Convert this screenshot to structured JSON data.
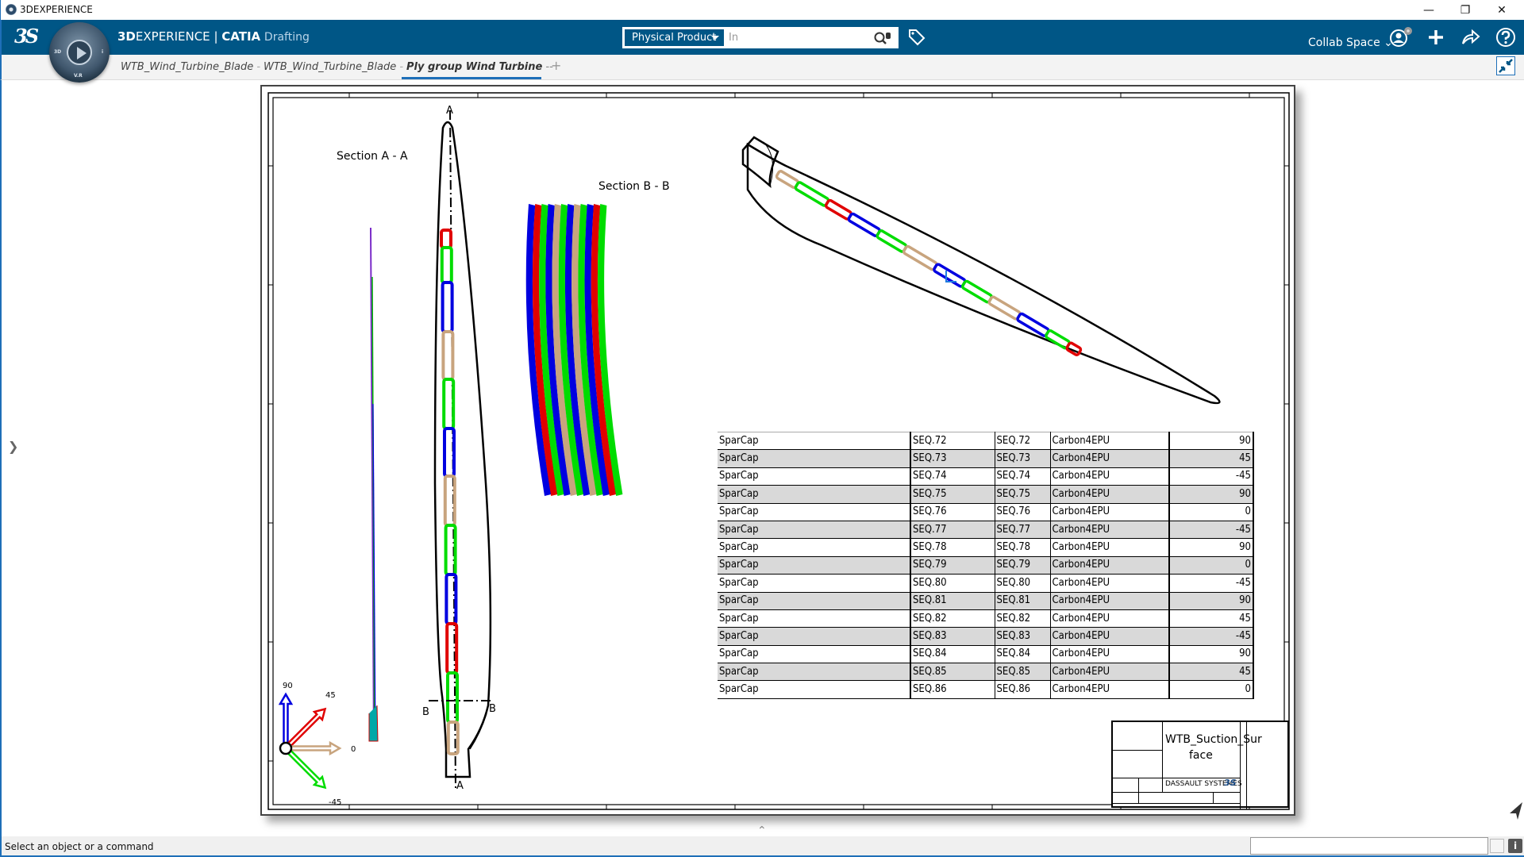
{
  "window": {
    "title": "3DEXPERIENCE",
    "controls": {
      "minimize": "—",
      "restore": "❐",
      "close": "✕"
    }
  },
  "header": {
    "brand_bold": "3D",
    "brand_rest": "EXPERIENCE",
    "brand_sep": " | ",
    "product": "CATIA",
    "app": "Drafting",
    "compass_labels": {
      "left": "3D",
      "right": "i",
      "bottom": "V.R"
    },
    "search": {
      "scope": "Physical Product",
      "value": "In",
      "placeholder": ""
    },
    "collab_space": "Collab Space ⌄",
    "icons": [
      "search-database-icon",
      "tag-icon",
      "user-profile-icon",
      "add-icon",
      "share-icon",
      "help-icon"
    ]
  },
  "tabs": [
    {
      "label": "WTB_Wind_Turbine_Blade",
      "suffix": " -",
      "active": false
    },
    {
      "label": "WTB_Wind_Turbine_Blade",
      "suffix": " -",
      "active": false
    },
    {
      "label": "Ply group Wind Turbine",
      "suffix": " --",
      "active": true
    }
  ],
  "add_tab": "+",
  "drawing": {
    "section_aa_label": "Section A - A",
    "section_bb_label": "Section B - B",
    "cut_labels": {
      "a_top": "A",
      "a_bottom": "A",
      "b_left": "B",
      "b_right": "B"
    },
    "orientation_triad": [
      {
        "angle_label": "90",
        "color": "#0000e0"
      },
      {
        "angle_label": "45",
        "color": "#e00000"
      },
      {
        "angle_label": "0",
        "color": "#c8a47e"
      },
      {
        "angle_label": "-45",
        "color": "#00dc00"
      }
    ],
    "section_bb_stripes": [
      "#0000e0",
      "#e00000",
      "#00dc00",
      "#0000e0",
      "#c8a47e",
      "#00dc00",
      "#0000e0",
      "#c8a47e",
      "#00dc00",
      "#0000e0",
      "#e00000",
      "#00dc00"
    ],
    "ply_table": [
      [
        "SparCap",
        "SEQ.72",
        "SEQ.72",
        "Carbon4EPU",
        "90"
      ],
      [
        "SparCap",
        "SEQ.73",
        "SEQ.73",
        "Carbon4EPU",
        "45"
      ],
      [
        "SparCap",
        "SEQ.74",
        "SEQ.74",
        "Carbon4EPU",
        "-45"
      ],
      [
        "SparCap",
        "SEQ.75",
        "SEQ.75",
        "Carbon4EPU",
        "90"
      ],
      [
        "SparCap",
        "SEQ.76",
        "SEQ.76",
        "Carbon4EPU",
        "0"
      ],
      [
        "SparCap",
        "SEQ.77",
        "SEQ.77",
        "Carbon4EPU",
        "-45"
      ],
      [
        "SparCap",
        "SEQ.78",
        "SEQ.78",
        "Carbon4EPU",
        "90"
      ],
      [
        "SparCap",
        "SEQ.79",
        "SEQ.79",
        "Carbon4EPU",
        "0"
      ],
      [
        "SparCap",
        "SEQ.80",
        "SEQ.80",
        "Carbon4EPU",
        "-45"
      ],
      [
        "SparCap",
        "SEQ.81",
        "SEQ.81",
        "Carbon4EPU",
        "90"
      ],
      [
        "SparCap",
        "SEQ.82",
        "SEQ.82",
        "Carbon4EPU",
        "45"
      ],
      [
        "SparCap",
        "SEQ.83",
        "SEQ.83",
        "Carbon4EPU",
        "-45"
      ],
      [
        "SparCap",
        "SEQ.84",
        "SEQ.84",
        "Carbon4EPU",
        "90"
      ],
      [
        "SparCap",
        "SEQ.85",
        "SEQ.85",
        "Carbon4EPU",
        "45"
      ],
      [
        "SparCap",
        "SEQ.86",
        "SEQ.86",
        "Carbon4EPU",
        "0"
      ]
    ],
    "title_block": {
      "drawing_title": "WTB_Suction_Surface",
      "title_line1": "WTB_Suction_Sur",
      "title_line2": "face",
      "company": "DASSAULT SYSTEMES"
    },
    "ply_colors": {
      "90": "#0000e0",
      "45": "#e00000",
      "0": "#c8a47e",
      "-45": "#00dc00"
    }
  },
  "status": {
    "message": "Select an object or a command",
    "command_input": ""
  },
  "colors": {
    "header_bg": "#005686",
    "accent": "#1e6fb8"
  }
}
